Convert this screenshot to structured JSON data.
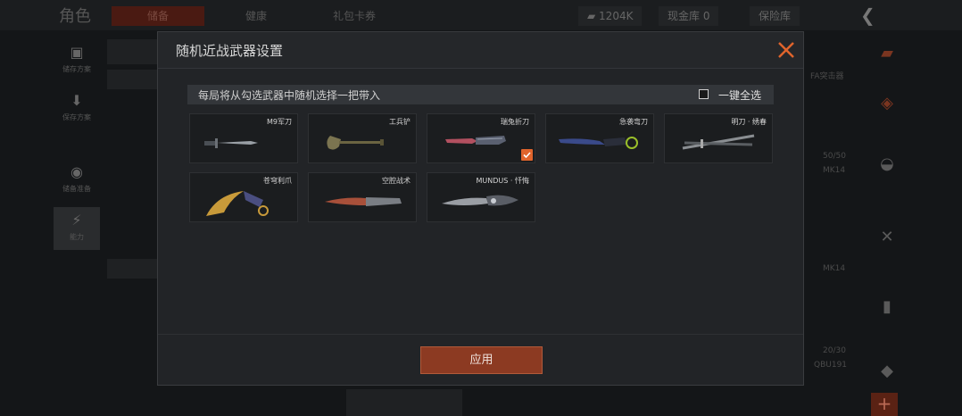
{
  "background": {
    "title": "角色",
    "tabs": [
      "储备",
      "健康",
      "礼包卡券"
    ],
    "currency_amount": "1204K",
    "cash_box": "现金库 0",
    "vault": "保险库",
    "left_rail": [
      "储存方案",
      "保存方案",
      "储备准备",
      "能力"
    ],
    "right_labels": [
      "FA突击器",
      "50/50",
      "MK14",
      "MK14",
      "20/30",
      "QBU191"
    ]
  },
  "modal": {
    "title": "随机近战武器设置",
    "banner_text": "每局将从勾选武器中随机选择一把带入",
    "select_all_label": "一键全选",
    "select_all_checked": false,
    "apply_label": "应用",
    "weapons": [
      {
        "name": "M9军刀",
        "icon": "m9-bayonet-icon",
        "checked": false
      },
      {
        "name": "工兵铲",
        "icon": "shovel-icon",
        "checked": false
      },
      {
        "name": "瑞兔折刀",
        "icon": "folding-knife-icon",
        "checked": true
      },
      {
        "name": "急袭弯刀",
        "icon": "curved-blade-icon",
        "checked": false
      },
      {
        "name": "明刀 · 绣春",
        "icon": "sheathed-sword-icon",
        "checked": false
      },
      {
        "name": "苍穹利爪",
        "icon": "karambit-icon",
        "checked": false
      },
      {
        "name": "空腔战术",
        "icon": "tactical-knife-icon",
        "checked": false
      },
      {
        "name": "MUNDUS · 忏悔",
        "icon": "ornate-knife-icon",
        "checked": false
      }
    ]
  },
  "colors": {
    "accent": "#e0642c",
    "apply_button": "#8c3a22",
    "modal_bg": "#222427",
    "card_bg": "#1b1d1f"
  }
}
